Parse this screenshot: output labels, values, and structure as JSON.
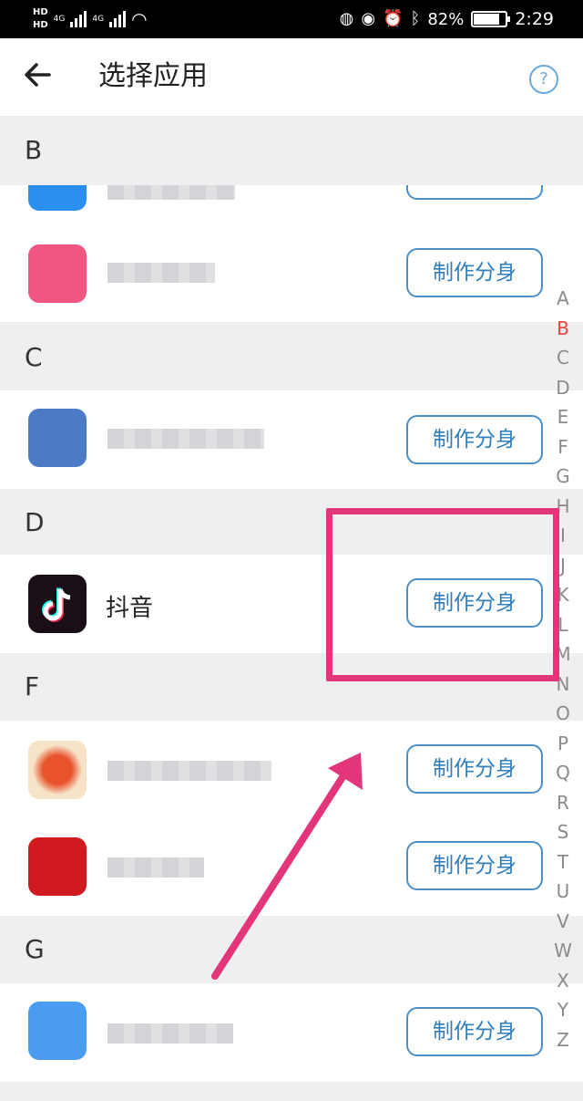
{
  "status_bar": {
    "hd_top": "HD",
    "hd_bottom": "HD",
    "net_type_1": "4G",
    "net_type_2": "4G",
    "battery_percent": "82%",
    "battery_level": 0.82,
    "time": "2:29",
    "icons": [
      "hd-icon",
      "signal-icon",
      "wifi-icon",
      "nfc-icon",
      "eye-icon",
      "alarm-icon",
      "bluetooth-vibrate-icon",
      "battery-icon"
    ]
  },
  "header": {
    "title": "选择应用",
    "back_icon": "back-arrow-icon",
    "help_label": "?"
  },
  "sections": [
    {
      "letter": "B"
    },
    {
      "letter": "C"
    },
    {
      "letter": "D"
    },
    {
      "letter": "F"
    },
    {
      "letter": "G"
    }
  ],
  "apps": [
    {
      "name": "",
      "button": "制作分身",
      "icon_color": "#2b8ff0"
    },
    {
      "name": "",
      "button": "制作分身",
      "icon_color": "#f0567f"
    },
    {
      "name": "",
      "button": "制作分身",
      "icon_color": "#4b7bc4"
    },
    {
      "name": "抖音",
      "button": "制作分身",
      "icon_color": "#1a0f17"
    },
    {
      "name": "",
      "button": "制作分身",
      "icon_color": "#e8532c"
    },
    {
      "name": "",
      "button": "制作分身",
      "icon_color": "#d11a1f"
    },
    {
      "name": "",
      "button": "制作分身",
      "icon_color": "#4a9cf0"
    }
  ],
  "index_letters": [
    "A",
    "B",
    "C",
    "D",
    "E",
    "F",
    "G",
    "H",
    "I",
    "J",
    "K",
    "L",
    "M",
    "N",
    "O",
    "P",
    "Q",
    "R",
    "S",
    "T",
    "U",
    "V",
    "W",
    "X",
    "Y",
    "Z"
  ],
  "index_active": "B",
  "colors": {
    "accent": "#4a90c8",
    "highlight_box": "#e2357a",
    "index_active": "#e0473f"
  }
}
